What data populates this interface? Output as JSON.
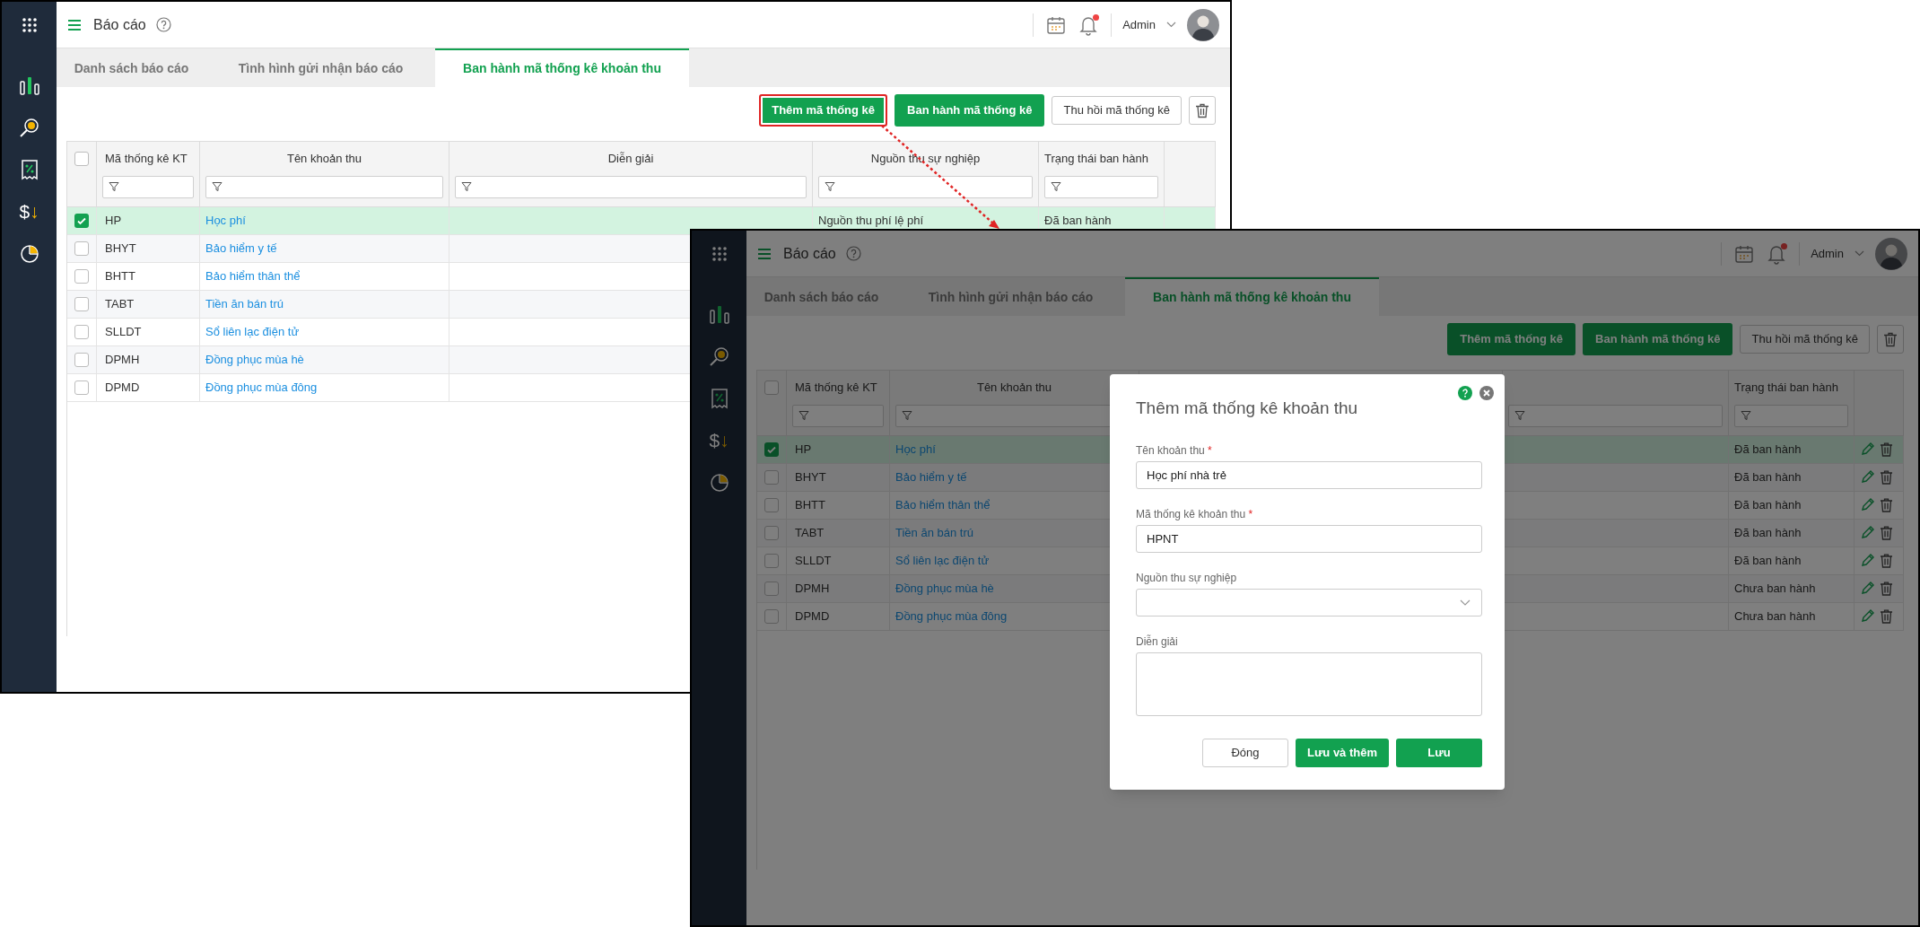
{
  "screens": [
    {
      "title": "Báo cáo",
      "user": "Admin",
      "notification_dot": true,
      "currency_icon": {
        "symbol": "$",
        "arrow": "↓"
      },
      "dimmed": false,
      "row_actions": false,
      "select_all": false,
      "tabs": [
        {
          "label": "Danh sách báo cáo",
          "selected": false
        },
        {
          "label": "Tình hình gửi nhận báo cáo",
          "selected": false
        },
        {
          "label": "Ban hành mã thống kê khoản thu",
          "selected": true
        }
      ],
      "toolbar": [
        {
          "kind": "primary",
          "label": "Thêm mã thống kê",
          "highlighted": true
        },
        {
          "kind": "primary",
          "label": "Ban hành mã thống kê",
          "highlighted": false
        },
        {
          "kind": "outline",
          "label": "Thu hồi mã thống kê",
          "highlighted": false
        },
        {
          "kind": "delete",
          "highlighted": false
        }
      ],
      "columns": [
        {
          "kind": "code",
          "label": "Mã thống kê KT",
          "filter": true
        },
        {
          "kind": "name",
          "label": "Tên khoản thu",
          "filter": true
        },
        {
          "kind": "description",
          "label": "Diễn giải",
          "filter": true
        },
        {
          "kind": "source",
          "label": "Nguồn thu sự nghiệp",
          "filter": true
        },
        {
          "kind": "status",
          "label": "Trạng thái ban hành",
          "filter": true
        },
        {
          "kind": "actions",
          "filter": false
        }
      ],
      "rows": [
        {
          "code": "HP",
          "name": "Học phí",
          "source": "Nguồn thu phí lệ phí",
          "status": "Đã ban hành",
          "selected": true
        },
        {
          "code": "BHYT",
          "name": "Bảo hiểm y tế",
          "selected": false
        },
        {
          "code": "BHTT",
          "name": "Bảo hiểm thân thể",
          "selected": false
        },
        {
          "code": "TABT",
          "name": "Tiền ăn bán trú",
          "selected": false
        },
        {
          "code": "SLLDT",
          "name": "Sổ liên lạc điện tử",
          "selected": false
        },
        {
          "code": "DPMH",
          "name": "Đồng phục mùa hè",
          "selected": false
        },
        {
          "code": "DPMD",
          "name": "Đồng phục mùa đông",
          "selected": false
        }
      ]
    },
    {
      "title": "Báo cáo",
      "user": "Admin",
      "notification_dot": true,
      "currency_icon": {
        "symbol": "$",
        "arrow": "↓"
      },
      "dimmed": true,
      "row_actions": true,
      "select_all": false,
      "tabs": [
        {
          "label": "Danh sách báo cáo",
          "selected": false
        },
        {
          "label": "Tình hình gửi nhận báo cáo",
          "selected": false
        },
        {
          "label": "Ban hành mã thống kê khoản thu",
          "selected": true
        }
      ],
      "toolbar": [
        {
          "kind": "primary",
          "label": "Thêm mã thống kê",
          "highlighted": false
        },
        {
          "kind": "primary",
          "label": "Ban hành mã thống kê",
          "highlighted": false
        },
        {
          "kind": "outline",
          "label": "Thu hồi mã thống kê",
          "highlighted": false
        },
        {
          "kind": "delete",
          "highlighted": false
        }
      ],
      "columns": [
        {
          "kind": "code",
          "label": "Mã thống kê KT",
          "filter": true
        },
        {
          "kind": "name",
          "label": "Tên khoản thu",
          "filter": true
        },
        {
          "kind": "description",
          "filter": false
        },
        {
          "kind": "source",
          "filter": true
        },
        {
          "kind": "status",
          "label": "Trạng thái ban hành",
          "filter": true
        },
        {
          "kind": "actions",
          "filter": false
        }
      ],
      "rows": [
        {
          "code": "HP",
          "name": "Học phí",
          "status": "Đã ban hành",
          "selected": true
        },
        {
          "code": "BHYT",
          "name": "Bảo hiểm y tế",
          "status": "Đã ban hành",
          "selected": false
        },
        {
          "code": "BHTT",
          "name": "Bảo hiểm thân thể",
          "status": "Đã ban hành",
          "selected": false
        },
        {
          "code": "TABT",
          "name": "Tiền ăn bán trú",
          "status": "Đã ban hành",
          "selected": false
        },
        {
          "code": "SLLDT",
          "name": "Sổ liên lạc điện tử",
          "status": "Đã ban hành",
          "selected": false
        },
        {
          "code": "DPMH",
          "name": "Đồng phục mùa hè",
          "status": "Chưa ban hành",
          "selected": false
        },
        {
          "code": "DPMD",
          "name": "Đồng phục mùa đông",
          "status": "Chưa ban hành",
          "selected": false
        }
      ],
      "dialog": {
        "title": "Thêm mã thống kê khoản thu",
        "fields": [
          {
            "kind": "text",
            "label": "Tên khoản thu",
            "required_mark": "*",
            "value": "Học phí nhà trẻ"
          },
          {
            "kind": "text",
            "label": "Mã thống kê khoản thu",
            "required_mark": "*",
            "value": "HPNT"
          },
          {
            "kind": "select",
            "label": "Nguồn thu sự nghiệp"
          },
          {
            "kind": "textarea",
            "label": "Diễn giải"
          }
        ],
        "buttons": [
          {
            "kind": "secondary",
            "label": "Đóng"
          },
          {
            "kind": "primary",
            "label": "Lưu và thêm"
          },
          {
            "kind": "primary",
            "label": "Lưu"
          }
        ]
      }
    }
  ]
}
